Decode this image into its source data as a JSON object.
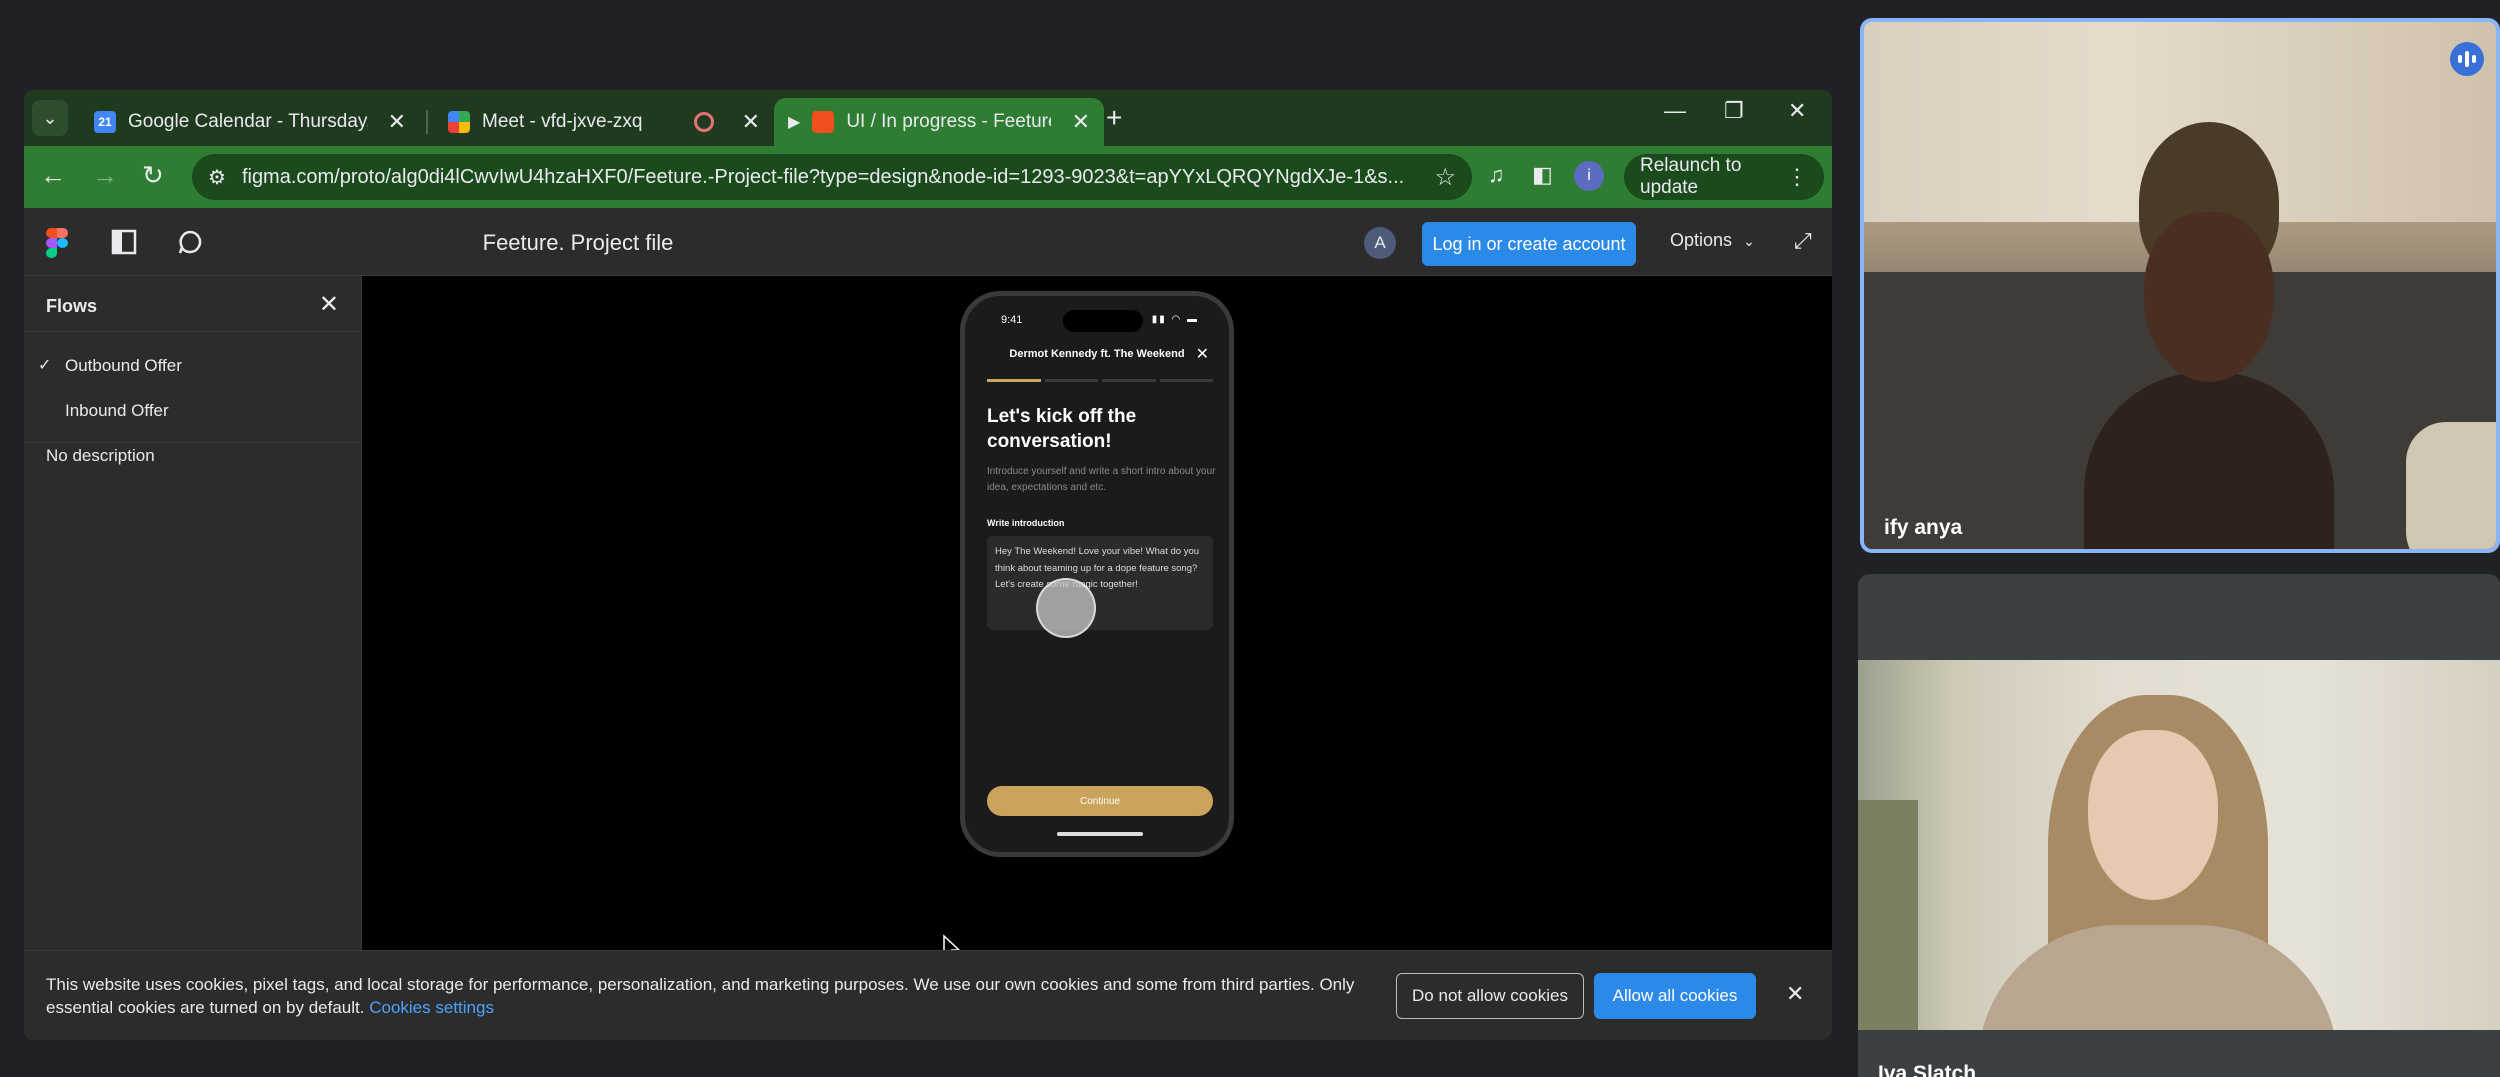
{
  "browser": {
    "tabs": [
      {
        "title": "Google Calendar - Thursday, M",
        "favicon": "calendar-favicon",
        "favicon_text": "21"
      },
      {
        "title": "Meet - vfd-jxve-zxq",
        "favicon": "meet-favicon"
      },
      {
        "title": "UI / In progress - Feeture. P",
        "favicon": "figma-favicon"
      }
    ],
    "url": "figma.com/proto/alg0di4lCwvIwU4hzaHXF0/Feeture.-Project-file?type=design&node-id=1293-9023&t=apYYxLQRQYNgdXJe-1&s...",
    "relaunch_label": "Relaunch to update",
    "profile_initial": "i"
  },
  "figma": {
    "file_title": "Feeture. Project file",
    "avatar_initial": "A",
    "login_label": "Log in or create account",
    "options_label": "Options"
  },
  "sidebar": {
    "title": "Flows",
    "flows": [
      {
        "label": "Outbound Offer",
        "selected": true
      },
      {
        "label": "Inbound Offer",
        "selected": false
      }
    ],
    "description": "No description"
  },
  "phone": {
    "time": "9:41",
    "header": "Dermot Kennedy ft. The Weekend",
    "progress_steps_done": 1,
    "progress_steps_total": 4,
    "heading": "Let's kick off the conversation!",
    "subtext": "Introduce yourself and write a short intro about your idea, expectations and etc.",
    "field_label": "Write introduction",
    "field_value": "Hey The Weekend! Love your vibe! What do you think about teaming up for a dope feature song? Let's create some magic together!",
    "button_label": "Continue"
  },
  "cookie_banner": {
    "text": "This website uses cookies, pixel tags, and local storage for performance, personalization, and marketing purposes. We use our own cookies and some from third parties. Only essential cookies are turned on by default.",
    "settings_link": "Cookies settings",
    "deny_label": "Do not allow cookies",
    "allow_label": "Allow all cookies"
  },
  "meet": {
    "participants": [
      {
        "name": "ify anya",
        "speaking": true
      },
      {
        "name": "Iva Slatch",
        "speaking": false
      }
    ]
  },
  "colors": {
    "chrome_green": "#2e7d32",
    "figma_blue": "#2b8ae8",
    "gold": "#c9a45a",
    "speaker_border": "#8ab4f8"
  }
}
